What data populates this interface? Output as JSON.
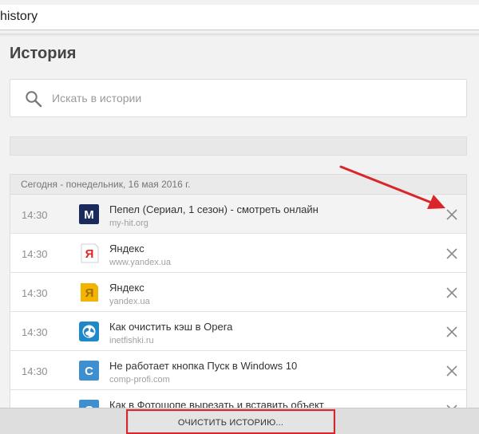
{
  "urlbar": {
    "text": "history"
  },
  "page": {
    "title": "История"
  },
  "search": {
    "placeholder": "Искать в истории"
  },
  "history": {
    "date_header": "Сегодня - понедельник, 16 мая 2016 г.",
    "items": [
      {
        "time": "14:30",
        "title": "Пепел (Сериал, 1 сезон) - смотреть онлайн",
        "url": "my-hit.org",
        "icon": "myhit-m-icon",
        "glyph": "M",
        "color": "#1b2a5c"
      },
      {
        "time": "14:30",
        "title": "Яндекс",
        "url": "www.yandex.ua",
        "icon": "yandex-red-icon",
        "glyph": "Я",
        "color": "#e52620"
      },
      {
        "time": "14:30",
        "title": "Яндекс",
        "url": "yandex.ua",
        "icon": "yandex-yellow-icon",
        "glyph": "Я",
        "color": "#f2b400"
      },
      {
        "time": "14:30",
        "title": "Как очистить кэш в Opera",
        "url": "inetfishki.ru",
        "icon": "globe-icon",
        "glyph": "",
        "color": "#1e88c8"
      },
      {
        "time": "14:30",
        "title": "Не работает кнопка Пуск в Windows 10",
        "url": "comp-profi.com",
        "icon": "letter-c-icon",
        "glyph": "C",
        "color": "#3d8fd0"
      },
      {
        "time": "",
        "title": "Как в Фотошопе вырезать и вставить объект",
        "url": "",
        "icon": "letter-c-icon",
        "glyph": "C",
        "color": "#3d8fd0"
      }
    ]
  },
  "footer": {
    "clear_label": "ОЧИСТИТЬ ИСТОРИЮ..."
  },
  "colors": {
    "annotation": "#d9262b"
  }
}
